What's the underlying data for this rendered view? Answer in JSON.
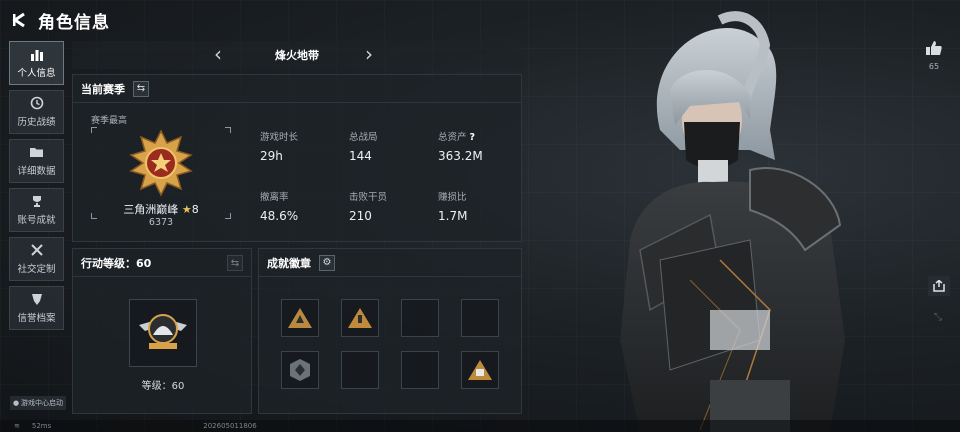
{
  "header": {
    "title": "角色信息"
  },
  "sidebar": {
    "items": [
      {
        "label": "个人信息",
        "icon": "bar-chart-icon",
        "active": true
      },
      {
        "label": "历史战绩",
        "icon": "history-clock-icon",
        "active": false
      },
      {
        "label": "详细数据",
        "icon": "folder-icon",
        "active": false
      },
      {
        "label": "账号成就",
        "icon": "trophy-icon",
        "active": false
      },
      {
        "label": "社交定制",
        "icon": "tools-icon",
        "active": false
      },
      {
        "label": "信誉档案",
        "icon": "shield-icon",
        "active": false
      }
    ],
    "footer_label": "游戏中心启动"
  },
  "tabbar": {
    "title": "烽火地带"
  },
  "season": {
    "title": "当前赛季",
    "best_label": "赛季最高",
    "rank_name": "三角洲巅峰",
    "rank_stars": "8",
    "rank_points": "6373",
    "stats": [
      {
        "label": "游戏时长",
        "value": "29h"
      },
      {
        "label": "总战局",
        "value": "144"
      },
      {
        "label": "总资产",
        "value": "363.2M",
        "help": "?"
      },
      {
        "label": "撤离率",
        "value": "48.6%"
      },
      {
        "label": "击败干员",
        "value": "210"
      },
      {
        "label": "赚损比",
        "value": "1.7M"
      }
    ]
  },
  "action_level": {
    "title": "行动等级：60",
    "level_label": "等级：60"
  },
  "achievements": {
    "title": "成就徽章"
  },
  "right": {
    "likes": "65"
  },
  "footer": {
    "ping": "52ms",
    "id": "202605011806"
  },
  "colors": {
    "accent_gold": "#d8a24a",
    "bg": "#161a1e",
    "panel": "#1e2328"
  }
}
